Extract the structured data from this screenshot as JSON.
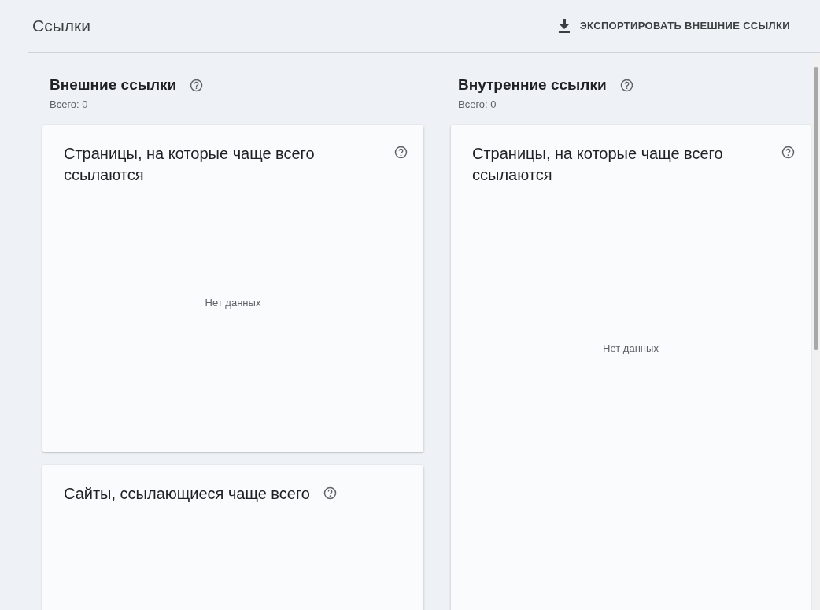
{
  "header": {
    "title": "Ссылки",
    "export_button": "ЭКСПОРТИРОВАТЬ ВНЕШНИЕ ССЫЛКИ"
  },
  "sections": [
    {
      "title": "Внешние ссылки",
      "total": "Всего: 0",
      "cards": [
        {
          "title": "Страницы, на которые чаще всего ссылаются",
          "empty_text": "Нет данных"
        },
        {
          "title": "Сайты, ссылающиеся чаще всего"
        }
      ]
    },
    {
      "title": "Внутренние ссылки",
      "total": "Всего: 0",
      "cards": [
        {
          "title": "Страницы, на которые чаще всего ссылаются",
          "empty_text": "Нет данных"
        }
      ]
    }
  ]
}
